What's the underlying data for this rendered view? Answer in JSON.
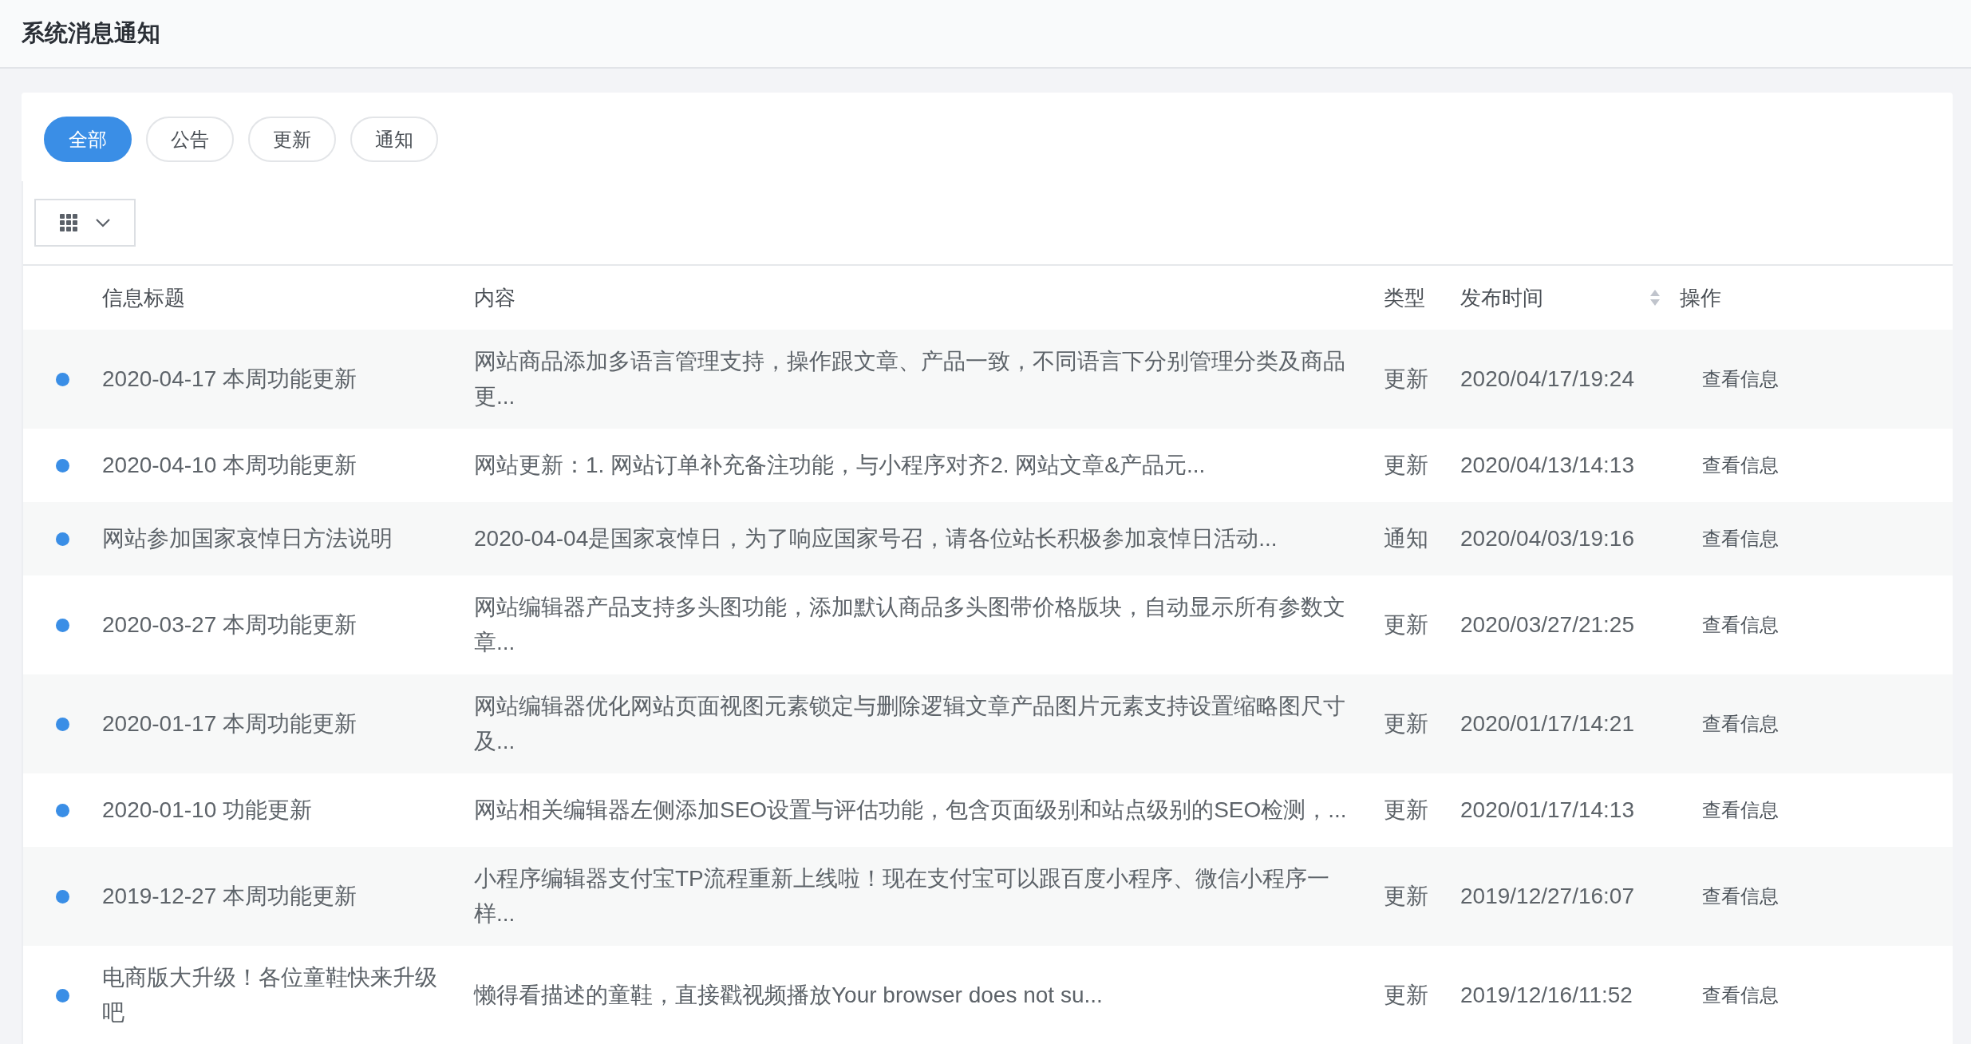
{
  "page_title": "系统消息通知",
  "filters": [
    {
      "label": "全部",
      "selected": true
    },
    {
      "label": "公告",
      "selected": false
    },
    {
      "label": "更新",
      "selected": false
    },
    {
      "label": "通知",
      "selected": false
    }
  ],
  "table": {
    "columns": [
      {
        "label": "信息标题",
        "sortable": false
      },
      {
        "label": "内容",
        "sortable": false
      },
      {
        "label": "类型",
        "sortable": false
      },
      {
        "label": "发布时间",
        "sortable": true
      },
      {
        "label": "操作",
        "sortable": false
      }
    ],
    "rows": [
      {
        "unread": true,
        "title": "2020-04-17 本周功能更新",
        "content": "网站商品添加多语言管理支持，操作跟文章、产品一致，不同语言下分别管理分类及商品更...",
        "type": "更新",
        "time": "2020/04/17/19:24",
        "action": "查看信息"
      },
      {
        "unread": true,
        "title": "2020-04-10 本周功能更新",
        "content": "网站更新：1. 网站订单补充备注功能，与小程序对齐2. 网站文章&产品元...",
        "type": "更新",
        "time": "2020/04/13/14:13",
        "action": "查看信息"
      },
      {
        "unread": true,
        "title": "网站参加国家哀悼日方法说明",
        "content": "2020-04-04是国家哀悼日，为了响应国家号召，请各位站长积极参加哀悼日活动...",
        "type": "通知",
        "time": "2020/04/03/19:16",
        "action": "查看信息"
      },
      {
        "unread": true,
        "title": "2020-03-27 本周功能更新",
        "content": "网站编辑器产品支持多头图功能，添加默认商品多头图带价格版块，自动显示所有参数文章...",
        "type": "更新",
        "time": "2020/03/27/21:25",
        "action": "查看信息"
      },
      {
        "unread": true,
        "title": "2020-01-17 本周功能更新",
        "content": "网站编辑器优化网站页面视图元素锁定与删除逻辑文章产品图片元素支持设置缩略图尺寸及...",
        "type": "更新",
        "time": "2020/01/17/14:21",
        "action": "查看信息"
      },
      {
        "unread": true,
        "title": "2020-01-10 功能更新",
        "content": "网站相关编辑器左侧添加SEO设置与评估功能，包含页面级别和站点级别的SEO检测，...",
        "type": "更新",
        "time": "2020/01/17/14:13",
        "action": "查看信息"
      },
      {
        "unread": true,
        "title": "2019-12-27 本周功能更新",
        "content": "小程序编辑器支付宝TP流程重新上线啦！现在支付宝可以跟百度小程序、微信小程序一样...",
        "type": "更新",
        "time": "2019/12/27/16:07",
        "action": "查看信息"
      },
      {
        "unread": true,
        "title": "电商版大升级！各位童鞋快来升级吧",
        "content": "懒得看描述的童鞋，直接戳视频播放Your browser does not su...",
        "type": "更新",
        "time": "2019/12/16/11:52",
        "action": "查看信息"
      }
    ]
  }
}
